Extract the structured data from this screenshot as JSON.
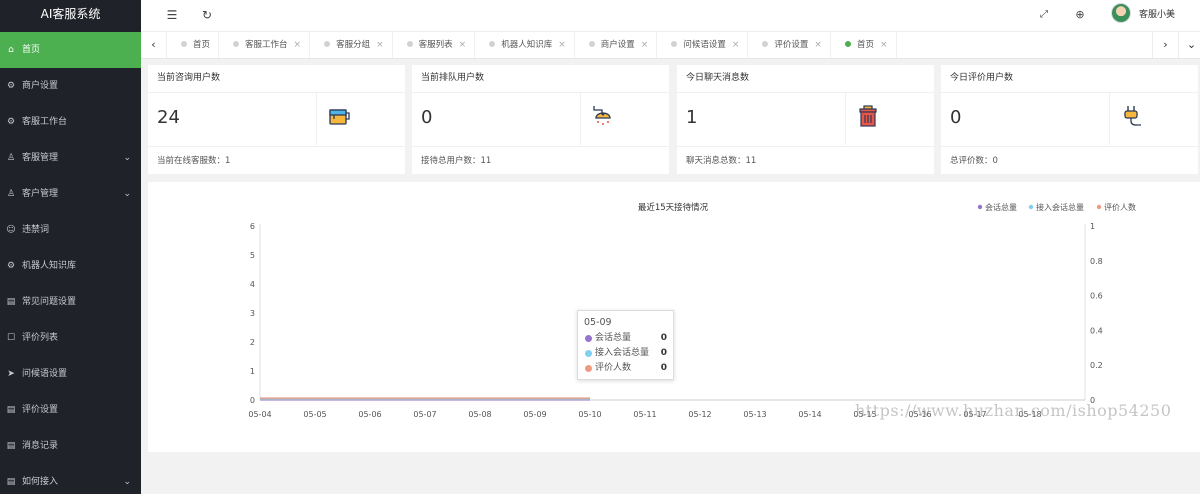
{
  "app": {
    "brand": "AI客服系统"
  },
  "sidebar": {
    "items": [
      {
        "label": "首页",
        "icon": "home-icon",
        "glyph": "⌂",
        "active": true,
        "has_children": false
      },
      {
        "label": "商户设置",
        "icon": "gear-icon",
        "glyph": "⚙",
        "active": false,
        "has_children": false
      },
      {
        "label": "客服工作台",
        "icon": "gear-icon",
        "glyph": "⚙",
        "active": false,
        "has_children": false
      },
      {
        "label": "客服管理",
        "icon": "user-icon",
        "glyph": "♙",
        "active": false,
        "has_children": true
      },
      {
        "label": "客户管理",
        "icon": "user-icon",
        "glyph": "♙",
        "active": false,
        "has_children": true
      },
      {
        "label": "违禁词",
        "icon": "smile-icon",
        "glyph": "☺",
        "active": false,
        "has_children": false
      },
      {
        "label": "机器人知识库",
        "icon": "gear-icon",
        "glyph": "⚙",
        "active": false,
        "has_children": false
      },
      {
        "label": "常见问题设置",
        "icon": "document-icon",
        "glyph": "▤",
        "active": false,
        "has_children": false
      },
      {
        "label": "评价列表",
        "icon": "chat-icon",
        "glyph": "☐",
        "active": false,
        "has_children": false
      },
      {
        "label": "问候语设置",
        "icon": "send-icon",
        "glyph": "➤",
        "active": false,
        "has_children": false
      },
      {
        "label": "评价设置",
        "icon": "document-icon",
        "glyph": "▤",
        "active": false,
        "has_children": false
      },
      {
        "label": "消息记录",
        "icon": "document-icon",
        "glyph": "▤",
        "active": false,
        "has_children": false
      },
      {
        "label": "如何接入",
        "icon": "document-icon",
        "glyph": "▤",
        "active": false,
        "has_children": true
      }
    ]
  },
  "header": {
    "menu_icon": "menu-fold-icon",
    "refresh_icon": "refresh-icon",
    "fullscreen_icon": "fullscreen-icon",
    "language_icon": "globe-icon",
    "username": "客服小美"
  },
  "tabs": [
    {
      "label": "首页",
      "active": false,
      "closable": false
    },
    {
      "label": "客服工作台",
      "active": false,
      "closable": true
    },
    {
      "label": "客服分组",
      "active": false,
      "closable": true
    },
    {
      "label": "客服列表",
      "active": false,
      "closable": true
    },
    {
      "label": "机器人知识库",
      "active": false,
      "closable": true
    },
    {
      "label": "商户设置",
      "active": false,
      "closable": true
    },
    {
      "label": "问候语设置",
      "active": false,
      "closable": true
    },
    {
      "label": "评价设置",
      "active": false,
      "closable": true
    },
    {
      "label": "首页",
      "active": true,
      "closable": true
    }
  ],
  "stats": [
    {
      "title": "当前咨询用户数",
      "value": "24",
      "footer": "当前在线客服数：1",
      "icon": "paint-bucket-icon"
    },
    {
      "title": "当前排队用户数",
      "value": "0",
      "footer": "接待总用户数：11",
      "icon": "shower-icon"
    },
    {
      "title": "今日聊天消息数",
      "value": "1",
      "footer": "聊天消息总数：11",
      "icon": "trash-can-icon"
    },
    {
      "title": "今日评价用户数",
      "value": "0",
      "footer": "总评价数：0",
      "icon": "plug-icon"
    }
  ],
  "colors": {
    "sidebar_bg": "#20222a",
    "accent": "#4caf50",
    "series_total": "#9575cd",
    "series_joined": "#80d0f0",
    "series_rating": "#ef9a80"
  },
  "chart_data": {
    "type": "line",
    "title": "最近15天接待情况",
    "legend_position": "top-right",
    "categories": [
      "05-04",
      "05-05",
      "05-06",
      "05-07",
      "05-08",
      "05-09",
      "05-10",
      "05-11",
      "05-12",
      "05-13",
      "05-14",
      "05-15",
      "05-16",
      "05-17",
      "05-18"
    ],
    "y_left": {
      "min": 0,
      "max": 6,
      "ticks": [
        0,
        1,
        2,
        3,
        4,
        5,
        6
      ]
    },
    "y_right": {
      "min": 0,
      "max": 1,
      "ticks": [
        "0",
        "0.2",
        "0.4",
        "0.6",
        "0.8",
        "1"
      ]
    },
    "series": [
      {
        "name": "会话总量",
        "color": "#9575cd",
        "values": [
          0,
          0,
          0,
          0,
          0,
          0,
          0,
          null,
          null,
          null,
          null,
          null,
          null,
          null,
          null
        ]
      },
      {
        "name": "接入会话总量",
        "color": "#80d0f0",
        "values": [
          0,
          0,
          0,
          0,
          0,
          0,
          0,
          null,
          null,
          null,
          null,
          null,
          null,
          null,
          null
        ]
      },
      {
        "name": "评价人数",
        "color": "#ef9a80",
        "values": [
          0,
          0,
          0,
          0,
          0,
          0,
          0,
          null,
          null,
          null,
          null,
          null,
          null,
          null,
          null
        ]
      }
    ],
    "tooltip": {
      "title": "05-09",
      "rows": [
        {
          "name": "会话总量",
          "value": "0",
          "color": "#9575cd"
        },
        {
          "name": "接入会话总量",
          "value": "0",
          "color": "#80d0f0"
        },
        {
          "name": "评价人数",
          "value": "0",
          "color": "#ef9a80"
        }
      ]
    }
  },
  "watermark": "https://www.huzhan.com/ishop54250"
}
